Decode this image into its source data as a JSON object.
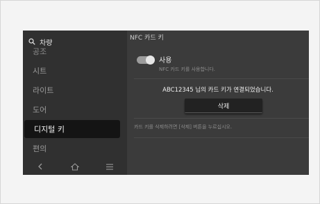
{
  "search": {
    "label": "차량"
  },
  "sidebar": {
    "items": [
      {
        "label": "공조"
      },
      {
        "label": "시트"
      },
      {
        "label": "라이트"
      },
      {
        "label": "도어"
      },
      {
        "label": "디지털 키"
      },
      {
        "label": "편의"
      }
    ],
    "active_index": 4
  },
  "content": {
    "title": "NFC 카드 키",
    "toggle": {
      "label": "사용",
      "description": "NFC 카드 키를 사용합니다.",
      "on": true
    },
    "card_message": "ABC12345 님의 카드 키가 연결되었습니다.",
    "delete_label": "삭제",
    "hint": "카드 키를 삭제하려면 [삭제] 버튼을 누르십시오."
  },
  "nav": {
    "icons": [
      "back-icon",
      "home-icon",
      "menu-icon"
    ]
  }
}
